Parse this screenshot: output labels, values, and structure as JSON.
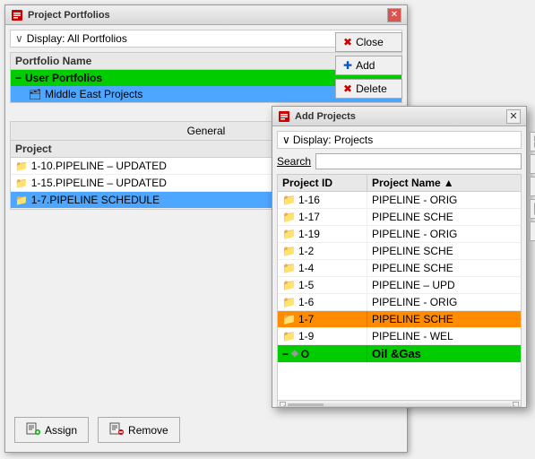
{
  "mainWindow": {
    "title": "Project Portfolios",
    "displayBar": "Display: All Portfolios",
    "tableHeader": "Portfolio Name",
    "portfolioSection": "User Portfolios",
    "portfolioItem": "Middle East Projects",
    "generalHeader": "General",
    "projectHeader": "Project",
    "projects": [
      {
        "id": "p1",
        "name": "1-10.PIPELINE – UPDATED",
        "selected": false
      },
      {
        "id": "p2",
        "name": "1-15.PIPELINE – UPDATED",
        "selected": false
      },
      {
        "id": "p3",
        "name": "1-7.PIPELINE SCHEDULE",
        "selected": true
      }
    ],
    "sideButtons": [
      {
        "label": "Close",
        "icon": "✖",
        "name": "close-button"
      },
      {
        "label": "Add",
        "icon": "✚",
        "name": "add-button"
      },
      {
        "label": "Delete",
        "icon": "✖",
        "name": "delete-button"
      }
    ],
    "bottomButtons": [
      {
        "label": "Assign",
        "name": "assign-button"
      },
      {
        "label": "Remove",
        "name": "remove-button"
      }
    ]
  },
  "modal": {
    "title": "Add Projects",
    "displayBar": "Display: Projects",
    "searchLabel": "Search",
    "searchPlaceholder": "",
    "colIdLabel": "Project ID",
    "colNameLabel": "Project Name",
    "sortArrow": "▲",
    "rows": [
      {
        "id": "1-16",
        "name": "PIPELINE - ORIG",
        "selected": false,
        "type": "project"
      },
      {
        "id": "1-17",
        "name": "PIPELINE SCHE",
        "selected": false,
        "type": "project"
      },
      {
        "id": "1-19",
        "name": "PIPELINE - ORIG",
        "selected": false,
        "type": "project"
      },
      {
        "id": "1-2",
        "name": "PIPELINE SCHE",
        "selected": false,
        "type": "project"
      },
      {
        "id": "1-4",
        "name": "PIPELINE SCHE",
        "selected": false,
        "type": "project"
      },
      {
        "id": "1-5",
        "name": "PIPELINE – UPD",
        "selected": false,
        "type": "project"
      },
      {
        "id": "1-6",
        "name": "PIPELINE - ORIG",
        "selected": false,
        "type": "project"
      },
      {
        "id": "1-7",
        "name": "PIPELINE SCHE",
        "selected": true,
        "type": "project"
      },
      {
        "id": "1-9",
        "name": "PIPELINE - WEL",
        "selected": false,
        "type": "project"
      },
      {
        "id": "O",
        "name": "Oil &Gas",
        "selected": false,
        "type": "section"
      }
    ],
    "sideIcons": [
      "⊞",
      "⊟",
      "⊠",
      "⊡",
      "⊛"
    ]
  }
}
